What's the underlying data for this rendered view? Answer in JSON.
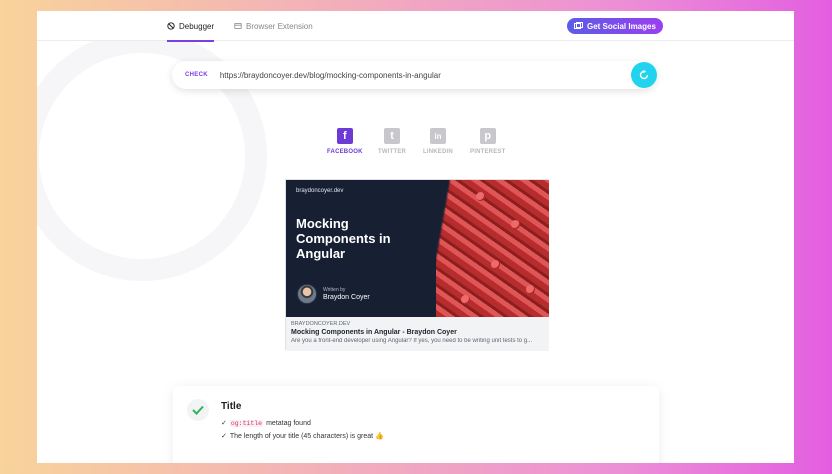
{
  "tabs": [
    {
      "label": "Debugger",
      "icon": "bug-icon",
      "active": true
    },
    {
      "label": "Browser Extension",
      "icon": "extension-icon",
      "active": false
    }
  ],
  "header": {
    "social_button_label": "Get Social Images"
  },
  "check": {
    "label": "CHECK",
    "url": "https://braydoncoyer.dev/blog/mocking-components-in-angular"
  },
  "platforms": [
    {
      "label": "FACEBOOK",
      "glyph": "f",
      "active": true
    },
    {
      "label": "TWITTER",
      "glyph": "t",
      "active": false
    },
    {
      "label": "LINKEDIN",
      "glyph": "in",
      "active": false
    },
    {
      "label": "PINTEREST",
      "glyph": "p",
      "active": false
    }
  ],
  "preview": {
    "image": {
      "domain": "braydoncoyer.dev",
      "title": "Mocking Components in Angular",
      "written_by": "Written by",
      "author": "Braydon Coyer"
    },
    "meta": {
      "domain": "BRAYDONCOYER.DEV",
      "title": "Mocking Components in Angular - Braydon Coyer",
      "description": "Are you a front-end developer using Angular? If yes, you need to be writing unit tests to g..."
    }
  },
  "result": {
    "title": "Title",
    "lines": {
      "tag": "og:title",
      "tag_suffix": "metatag found",
      "length_text": "The length of your title (45 characters) is great 👍"
    }
  },
  "colors": {
    "accent": "#7b3fe4",
    "refresh": "#22d3ee",
    "success": "#2fb35a"
  }
}
